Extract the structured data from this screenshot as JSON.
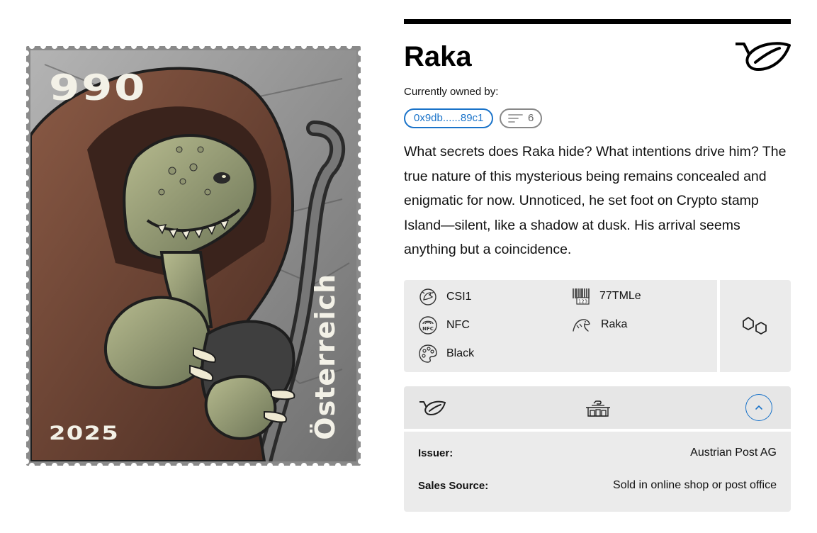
{
  "stamp": {
    "value": "990",
    "year": "2025",
    "country": "Österreich"
  },
  "product": {
    "title": "Raka",
    "owned_label": "Currently owned by:",
    "owner_address": "0x9db......89c1",
    "owner_count": "6",
    "description": "What secrets does Raka hide? What intentions drive him? The true nature of this mysterious being remains concealed and enigmatic for now. Unnoticed, he set foot on Crypto stamp Island—silent, like a shadow at dusk. His arrival seems anything but a coincidence."
  },
  "attributes": {
    "series": "CSI1",
    "code": "77TMLe",
    "nfc": "NFC",
    "character": "Raka",
    "color": "Black"
  },
  "issuer": {
    "issuer_label": "Issuer:",
    "issuer_value": "Austrian Post AG",
    "sales_label": "Sales Source:",
    "sales_value": "Sold in online shop or post office"
  },
  "colors": {
    "accent": "#1a73c9",
    "panel": "#ebebeb",
    "rule": "#000000"
  },
  "icons": {
    "brand": "post-horn-icon",
    "series": "dragon-badge-icon",
    "code": "barcode-123-icon",
    "nfc": "nfc-icon",
    "character": "creature-icon",
    "color": "palette-icon",
    "chain": "polygon-chain-icon",
    "shop": "post-office-icon",
    "collapse": "chevron-up-icon"
  }
}
